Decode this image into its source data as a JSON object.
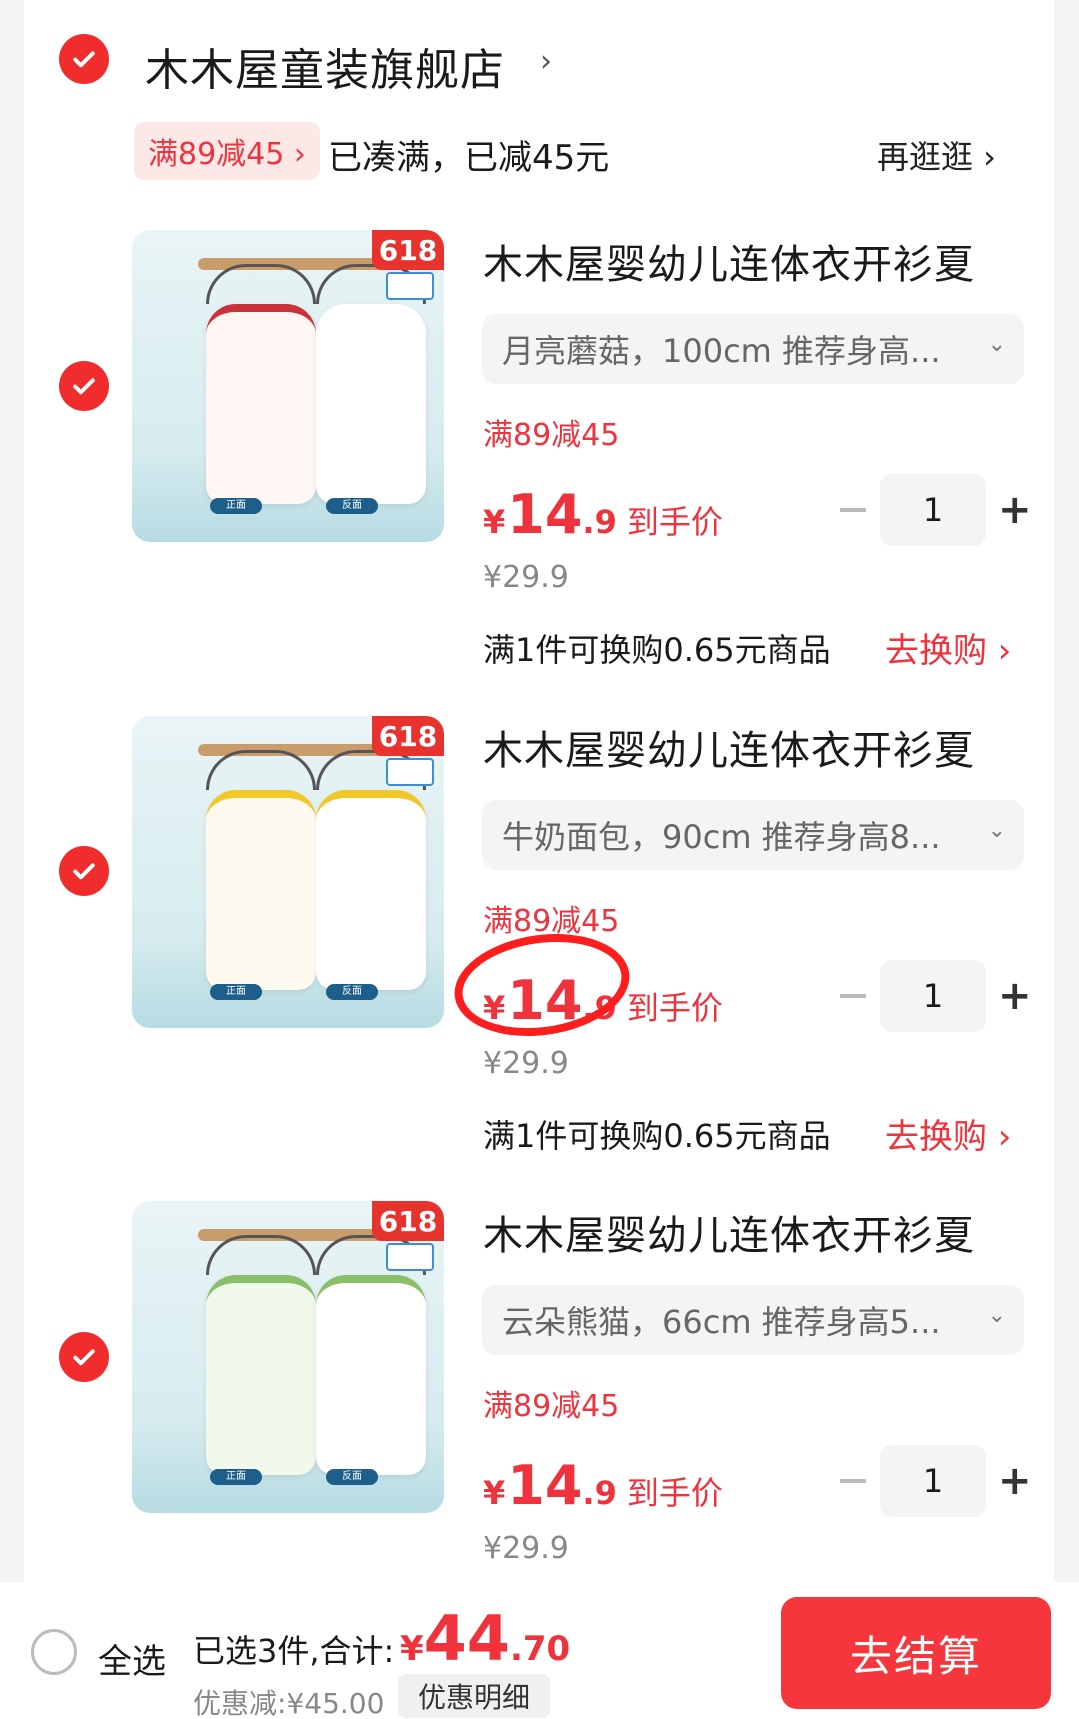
{
  "store": {
    "name": "木木屋童装旗舰店",
    "chevron": "›",
    "promo_tag": "满89减45 ›",
    "promo_status": "已凑满，已减45元",
    "stroll": "再逛逛 ›"
  },
  "items": [
    {
      "badge": "618",
      "thumb_labels": [
        "正面",
        "反面"
      ],
      "title": "木木屋婴幼儿连体衣开衫夏",
      "sku": "月亮蘑菇，100cm 推荐身高...",
      "promo": "满89减45",
      "price_yen": "¥",
      "price_int": "14",
      "price_dec": ".9",
      "price_suffix": "到手价",
      "original_price": "¥29.9",
      "quantity": "1",
      "swap_text": "满1件可换购0.65元商品",
      "swap_link": "去换购 ›"
    },
    {
      "badge": "618",
      "thumb_labels": [
        "正面",
        "反面"
      ],
      "title": "木木屋婴幼儿连体衣开衫夏",
      "sku": "牛奶面包，90cm 推荐身高8...",
      "promo": "满89减45",
      "price_yen": "¥",
      "price_int": "14",
      "price_dec": ".9",
      "price_suffix": "到手价",
      "original_price": "¥29.9",
      "quantity": "1",
      "swap_text": "满1件可换购0.65元商品",
      "swap_link": "去换购 ›"
    },
    {
      "badge": "618",
      "thumb_labels": [
        "正面",
        "反面"
      ],
      "title": "木木屋婴幼儿连体衣开衫夏",
      "sku": "云朵熊猫，66cm 推荐身高5...",
      "promo": "满89减45",
      "price_yen": "¥",
      "price_int": "14",
      "price_dec": ".9",
      "price_suffix": "到手价",
      "original_price": "¥29.9",
      "quantity": "1"
    }
  ],
  "footer": {
    "select_all": "全选",
    "selected_count": "已选3件,合计:",
    "total_yen": "¥",
    "total_int": "44",
    "total_dec": ".70",
    "discount": "优惠减:¥45.00",
    "detail_button": "优惠明细",
    "checkout_button": "去结算"
  },
  "colors": {
    "accent": "#f0323c",
    "check": "#f02c2c",
    "checkout": "#f5363d",
    "annotation": "#ff1e1e"
  },
  "icons": {
    "check": "check-icon",
    "chevron": "chevron-right-icon",
    "dropdown": "chevron-down-icon",
    "minus": "minus-icon",
    "plus": "plus-icon"
  }
}
